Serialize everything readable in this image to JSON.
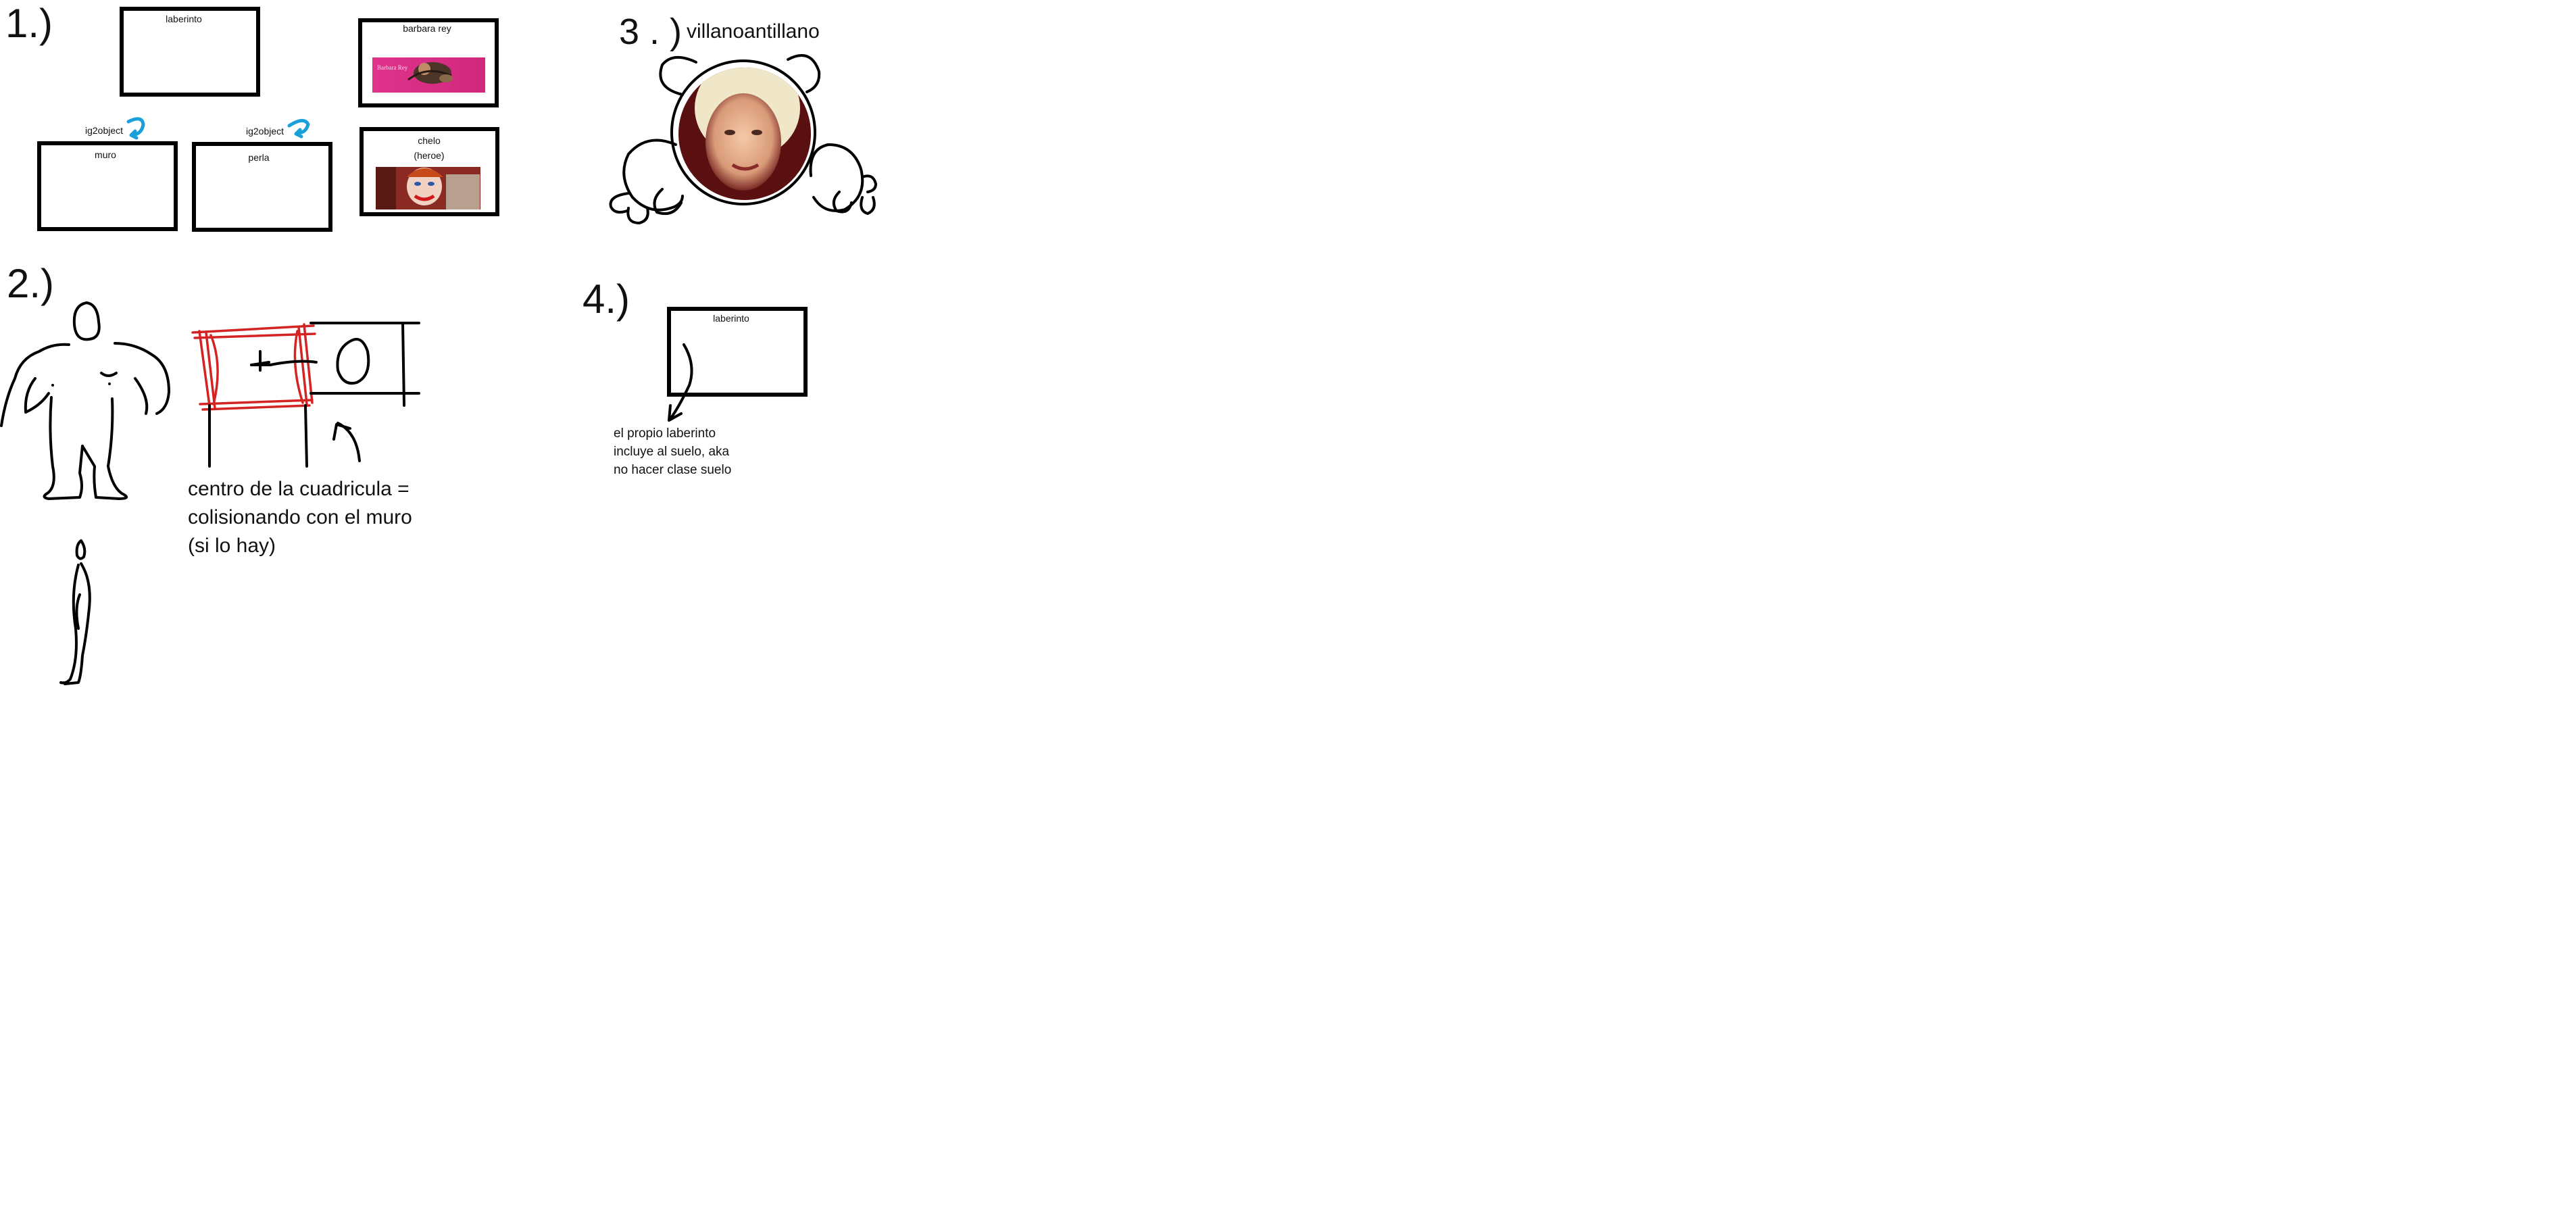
{
  "section_numbers": [
    "1.)",
    "2.)",
    "3 . )",
    "4.)"
  ],
  "section1": {
    "laberinto_box": {
      "label": "laberinto"
    },
    "muro_box": {
      "label": "muro",
      "tag": "ig2object"
    },
    "perla_box": {
      "label": "perla",
      "tag": "ig2object"
    },
    "barbara_box": {
      "label": "barbara rey"
    },
    "chelo_box": {
      "label_line1": "chelo",
      "label_line2": "(heroe)"
    }
  },
  "section2": {
    "note_lines": [
      "centro de la cuadricula =",
      "colisionando con el muro",
      "(si lo hay)"
    ]
  },
  "section3": {
    "title": "villanoantillano"
  },
  "section4": {
    "laberinto_box": {
      "label": "laberinto"
    },
    "note_lines": [
      "el propio laberinto",
      "incluye al suelo, aka",
      "no hacer clase suelo"
    ]
  },
  "colors": {
    "ink": "#000000",
    "red_marker": "#d42323",
    "blue_marker": "#1aa0d8",
    "barbara_background": "#e0338c"
  },
  "icons": [
    "curved-arrow-icon",
    "arrow-icon"
  ]
}
